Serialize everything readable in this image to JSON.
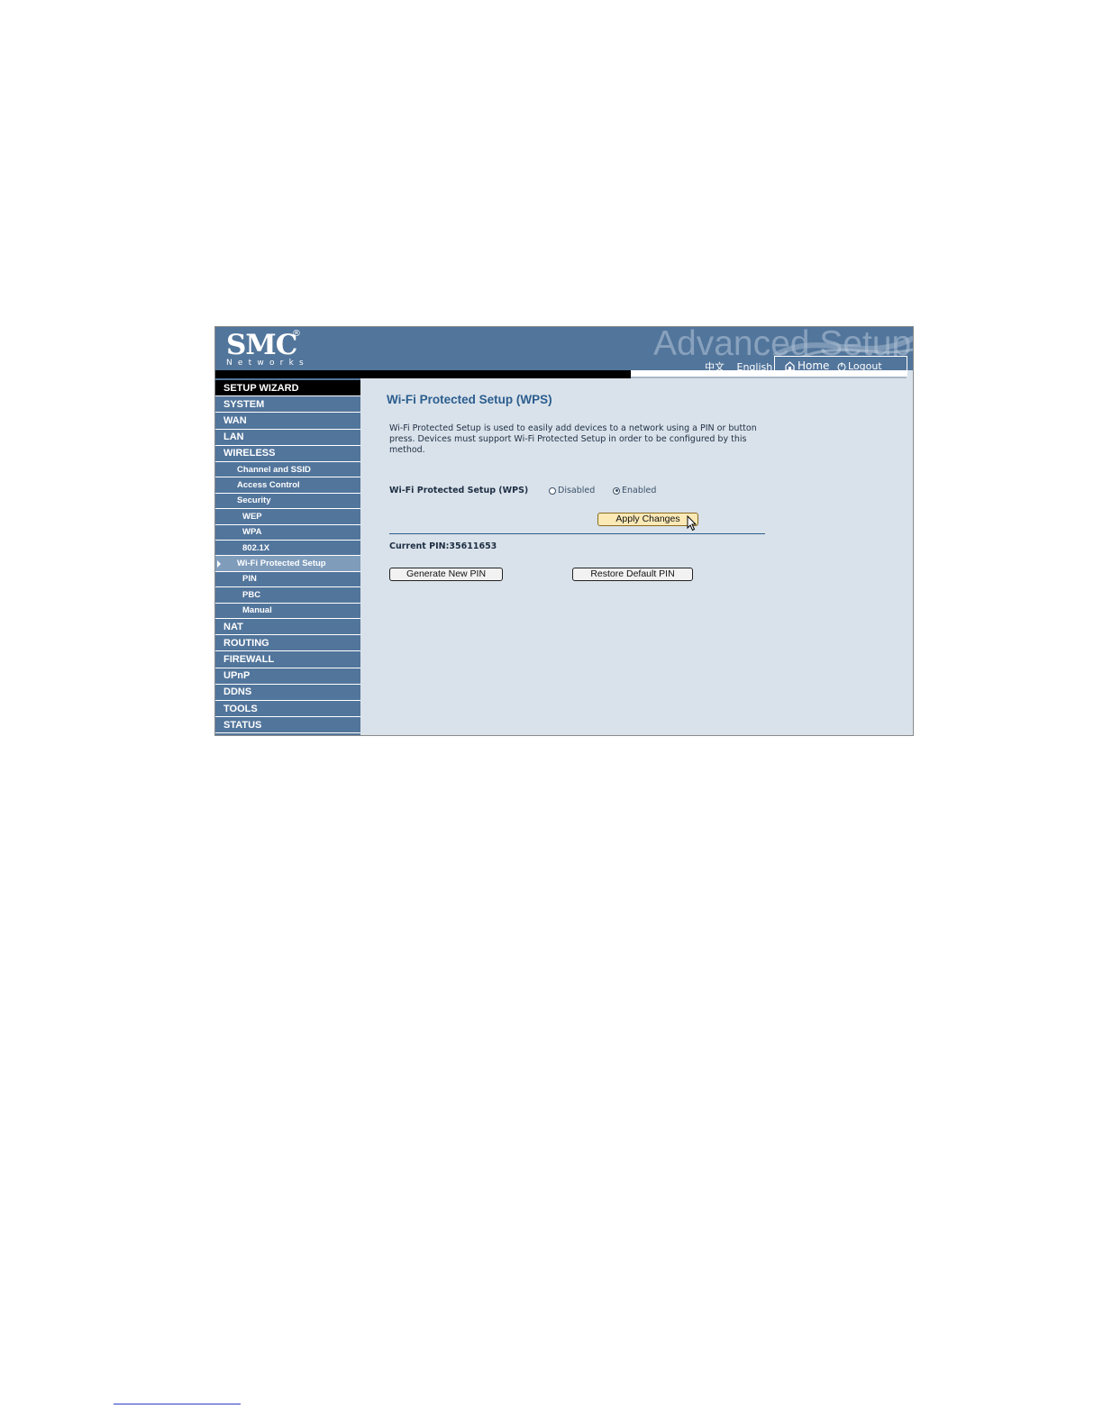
{
  "header": {
    "logo_text": "SMC",
    "logo_sub": "Networks",
    "bg_title": "Advanced Setup",
    "lang_cn": "中文",
    "lang_en": "English",
    "home": "Home",
    "logout": "Logout"
  },
  "sidebar": {
    "wizard": "SETUP WIZARD",
    "system": "SYSTEM",
    "wan": "WAN",
    "lan": "LAN",
    "wireless": "WIRELESS",
    "channel": "Channel and SSID",
    "access": "Access Control",
    "security": "Security",
    "wep": "WEP",
    "wpa": "WPA",
    "dot1x": "802.1X",
    "wps": "Wi-Fi Protected Setup",
    "pin": "PIN",
    "pbc": "PBC",
    "manual": "Manual",
    "nat": "NAT",
    "routing": "ROUTING",
    "firewall": "FIREWALL",
    "upnp": "UPnP",
    "ddns": "DDNS",
    "tools": "TOOLS",
    "status": "STATUS"
  },
  "main": {
    "title": "Wi-Fi Protected Setup (WPS)",
    "description": "Wi-Fi Protected Setup is used to easily add devices to a network using a PIN or button press. Devices must support Wi-Fi Protected Setup in order to be configured by this method.",
    "wps_label": "Wi-Fi Protected Setup (WPS)",
    "opt_disabled": "Disabled",
    "opt_enabled": "Enabled",
    "selected": "Enabled",
    "apply": "Apply Changes",
    "current_pin": "Current PIN:35611653",
    "generate": "Generate New PIN",
    "restore": "Restore Default PIN"
  },
  "colors": {
    "header_bg": "#52759b",
    "content_bg": "#d9e2ea",
    "title": "#2b5d8e"
  }
}
